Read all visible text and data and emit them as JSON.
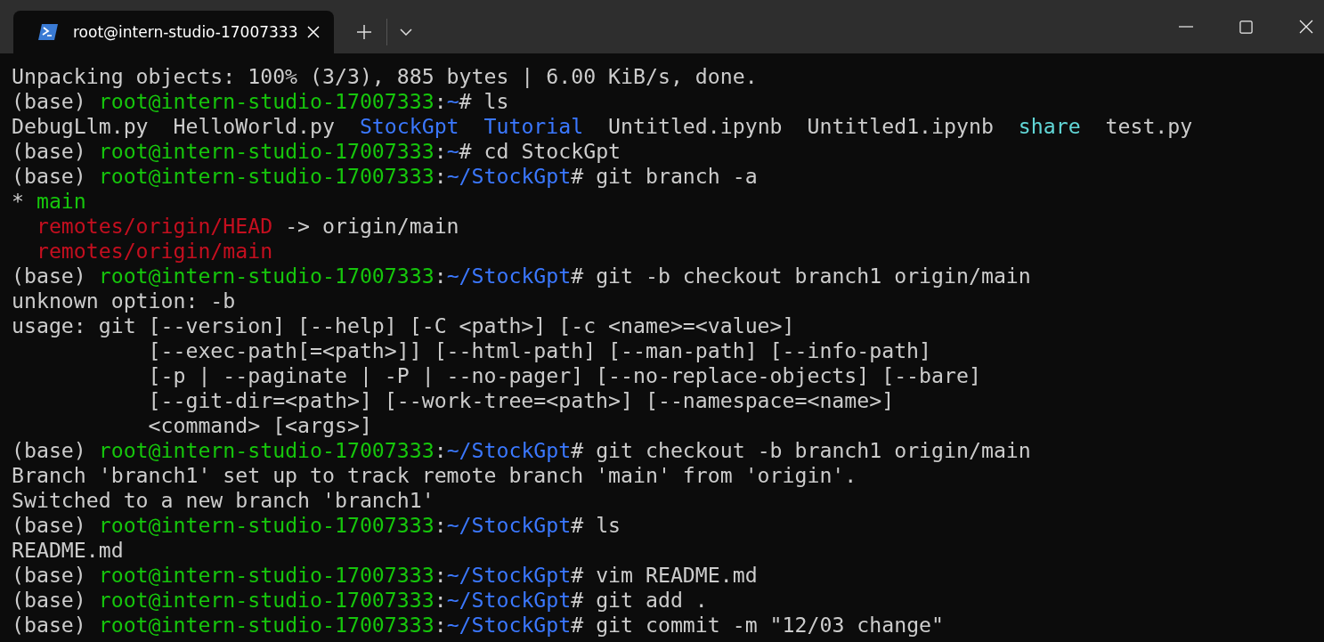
{
  "tab": {
    "title": "root@intern-studio-17007333",
    "selected": true
  },
  "lines": [
    [
      {
        "kind": "plain",
        "text": "Unpacking objects: 100% (3/3), 885 bytes | 6.00 KiB/s, done."
      }
    ],
    [
      {
        "kind": "plain",
        "text": "(base) "
      },
      {
        "kind": "user",
        "text": "root@intern-studio-17007333"
      },
      {
        "kind": "plain",
        "text": ":"
      },
      {
        "kind": "path",
        "text": "~"
      },
      {
        "kind": "plain",
        "text": "# ls"
      }
    ],
    [
      {
        "kind": "plain",
        "text": "DebugLlm.py  HelloWorld.py  "
      },
      {
        "kind": "dir",
        "text": "StockGpt"
      },
      {
        "kind": "dir",
        "text": "  Tutorial"
      },
      {
        "kind": "plain",
        "text": "  Untitled.ipynb  Untitled1.ipynb  "
      },
      {
        "kind": "link",
        "text": "share"
      },
      {
        "kind": "plain",
        "text": "  test.py"
      }
    ],
    [
      {
        "kind": "plain",
        "text": "(base) "
      },
      {
        "kind": "user",
        "text": "root@intern-studio-17007333"
      },
      {
        "kind": "plain",
        "text": ":"
      },
      {
        "kind": "path",
        "text": "~"
      },
      {
        "kind": "plain",
        "text": "# cd StockGpt"
      }
    ],
    [
      {
        "kind": "plain",
        "text": "(base) "
      },
      {
        "kind": "user",
        "text": "root@intern-studio-17007333"
      },
      {
        "kind": "plain",
        "text": ":"
      },
      {
        "kind": "path",
        "text": "~/StockGpt"
      },
      {
        "kind": "plain",
        "text": "# git branch -a"
      }
    ],
    [
      {
        "kind": "plain",
        "text": "* "
      },
      {
        "kind": "user",
        "text": "main"
      }
    ],
    [
      {
        "kind": "remote",
        "text": "  remotes/origin/HEAD"
      },
      {
        "kind": "plain",
        "text": " -> origin/main"
      }
    ],
    [
      {
        "kind": "remote",
        "text": "  remotes/origin/main"
      }
    ],
    [
      {
        "kind": "plain",
        "text": "(base) "
      },
      {
        "kind": "user",
        "text": "root@intern-studio-17007333"
      },
      {
        "kind": "plain",
        "text": ":"
      },
      {
        "kind": "path",
        "text": "~/StockGpt"
      },
      {
        "kind": "plain",
        "text": "# git -b checkout branch1 origin/main"
      }
    ],
    [
      {
        "kind": "plain",
        "text": "unknown option: -b"
      }
    ],
    [
      {
        "kind": "plain",
        "text": "usage: git [--version] [--help] [-C <path>] [-c <name>=<value>]"
      }
    ],
    [
      {
        "kind": "plain",
        "text": "           [--exec-path[=<path>]] [--html-path] [--man-path] [--info-path]"
      }
    ],
    [
      {
        "kind": "plain",
        "text": "           [-p | --paginate | -P | --no-pager] [--no-replace-objects] [--bare]"
      }
    ],
    [
      {
        "kind": "plain",
        "text": "           [--git-dir=<path>] [--work-tree=<path>] [--namespace=<name>]"
      }
    ],
    [
      {
        "kind": "plain",
        "text": "           <command> [<args>]"
      }
    ],
    [
      {
        "kind": "plain",
        "text": "(base) "
      },
      {
        "kind": "user",
        "text": "root@intern-studio-17007333"
      },
      {
        "kind": "plain",
        "text": ":"
      },
      {
        "kind": "path",
        "text": "~/StockGpt"
      },
      {
        "kind": "plain",
        "text": "# git checkout -b branch1 origin/main"
      }
    ],
    [
      {
        "kind": "plain",
        "text": "Branch 'branch1' set up to track remote branch 'main' from 'origin'."
      }
    ],
    [
      {
        "kind": "plain",
        "text": "Switched to a new branch 'branch1'"
      }
    ],
    [
      {
        "kind": "plain",
        "text": "(base) "
      },
      {
        "kind": "user",
        "text": "root@intern-studio-17007333"
      },
      {
        "kind": "plain",
        "text": ":"
      },
      {
        "kind": "path",
        "text": "~/StockGpt"
      },
      {
        "kind": "plain",
        "text": "# ls"
      }
    ],
    [
      {
        "kind": "plain",
        "text": "README.md"
      }
    ],
    [
      {
        "kind": "plain",
        "text": "(base) "
      },
      {
        "kind": "user",
        "text": "root@intern-studio-17007333"
      },
      {
        "kind": "plain",
        "text": ":"
      },
      {
        "kind": "path",
        "text": "~/StockGpt"
      },
      {
        "kind": "plain",
        "text": "# vim README.md"
      }
    ],
    [
      {
        "kind": "plain",
        "text": "(base) "
      },
      {
        "kind": "user",
        "text": "root@intern-studio-17007333"
      },
      {
        "kind": "plain",
        "text": ":"
      },
      {
        "kind": "path",
        "text": "~/StockGpt"
      },
      {
        "kind": "plain",
        "text": "# git add ."
      }
    ],
    [
      {
        "kind": "plain",
        "text": "(base) "
      },
      {
        "kind": "user",
        "text": "root@intern-studio-17007333"
      },
      {
        "kind": "plain",
        "text": ":"
      },
      {
        "kind": "path",
        "text": "~/StockGpt"
      },
      {
        "kind": "plain",
        "text": "# git commit -m \"12/03 change\""
      }
    ]
  ]
}
